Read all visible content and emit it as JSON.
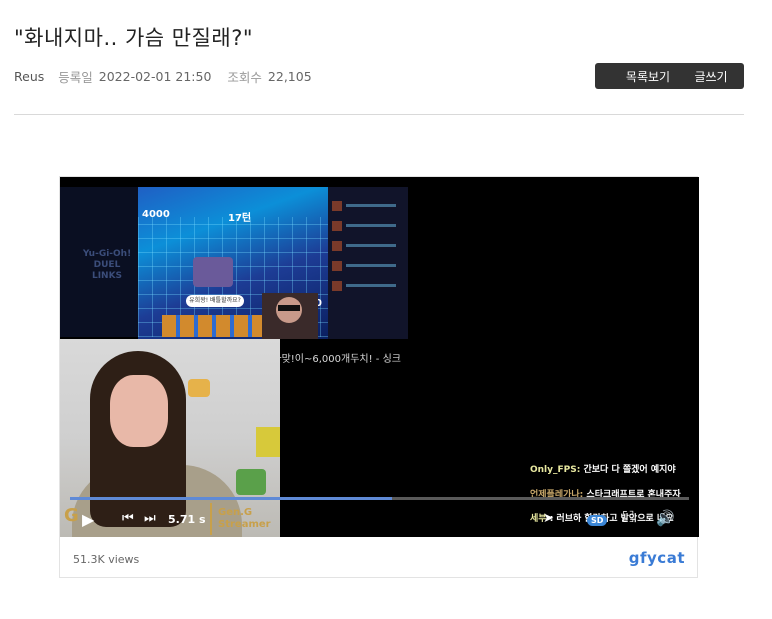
{
  "post": {
    "title": "\"화내지마.. 가슴 만질래?\"",
    "author": "Reus",
    "date_label": "등록일",
    "date": "2022-02-01 21:50",
    "views_label": "조회수",
    "views": "22,105"
  },
  "buttons": {
    "list": "목록보기",
    "write": "글쓰기"
  },
  "video": {
    "caption": "이건유희왕각이다맞!이~6,000개두치! - 싱크",
    "game_score_top": "4000",
    "game_score_bottom": "4000",
    "game_turn": "17턴",
    "game_bubble": "유희왕! 배틀할까요?",
    "left_logo": "Yu-Gi-Oh! DUEL LINKS",
    "chat": [
      {
        "nick": "Only_FPS:",
        "text": " 간보다 다 쫄겠어 예지야"
      },
      {
        "nick": "언제플레가나:",
        "text": " 스타크래프트로 혼내주자"
      },
      {
        "nick": "세부",
        "text": " : 러브하 할랑하고 발악으로 네요"
      }
    ],
    "time": "5.71 s",
    "progress": 0.52,
    "badge_line1": "Gen.G",
    "badge_line2": "Streamer",
    "quality": "SD"
  },
  "footer": {
    "views": "51.3K views",
    "brand": "gfycat"
  },
  "colors": {
    "button_bg": "#333333",
    "progress_fill": "#5f8ad6",
    "brand": "#3a7bd5"
  }
}
